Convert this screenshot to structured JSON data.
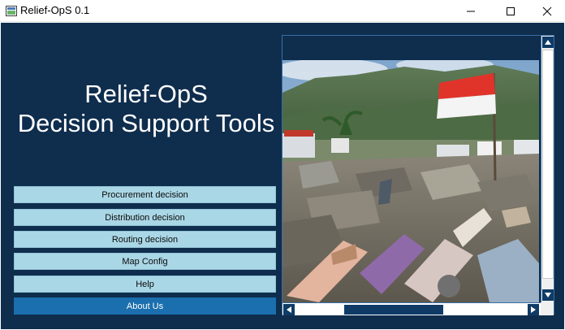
{
  "window": {
    "title": "Relief-OpS 0.1",
    "controls": {
      "minimize_icon": "minimize-icon",
      "maximize_icon": "maximize-icon",
      "close_icon": "close-icon"
    }
  },
  "header": {
    "line1": "Relief-OpS",
    "line2": "Decision Support Tools"
  },
  "menu": [
    {
      "label": "Procurement decision",
      "active": false
    },
    {
      "label": "Distribution decision",
      "active": false
    },
    {
      "label": "Routing decision",
      "active": false
    },
    {
      "label": "Map Config",
      "active": false
    },
    {
      "label": "Help",
      "active": false
    },
    {
      "label": "About Us",
      "active": true
    }
  ],
  "colors": {
    "background": "#0f2d4d",
    "button": "#aad7e6",
    "button_active": "#1b6fae",
    "scroll_accent": "#0f3b66"
  },
  "image_panel": {
    "scroll_vertical_position": 0.05,
    "scroll_horizontal_position": 0.3
  }
}
